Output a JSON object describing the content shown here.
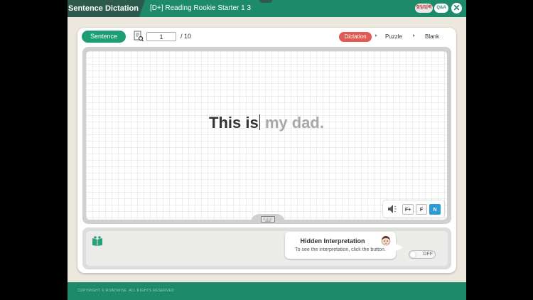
{
  "header": {
    "section_title": "Sentence Dictation",
    "book_title": "[D+] Reading Rookie Starter 1 3",
    "badge_answer": "정답입력",
    "badge_qa": "Q&A",
    "close_symbol": "✕"
  },
  "toolbar": {
    "mode_button": "Sentence",
    "current_page": "1",
    "total_pages": "/ 10",
    "tabs": [
      {
        "label": "Dictation",
        "active": true
      },
      {
        "label": "Puzzle",
        "active": false
      },
      {
        "label": "Blank",
        "active": false
      }
    ]
  },
  "board": {
    "typed_text": "This is",
    "remaining_text": "my dad."
  },
  "audio": {
    "speeds": [
      {
        "label": "F+",
        "active": false
      },
      {
        "label": "F",
        "active": false
      },
      {
        "label": "N",
        "active": true
      }
    ]
  },
  "interpretation": {
    "title": "Hidden Interpretation",
    "hint": "To see the interpretation, click the button.",
    "toggle_label": "OFF"
  },
  "footer": {
    "copyright": "COPYRIGHT © ROADWISE. ALL RIGHTS RESERVED"
  },
  "colors": {
    "brand_green": "#1d8a6a",
    "dark_green": "#2d5a4c",
    "pill_green": "#1e9e74",
    "active_tab_red": "#e15b53",
    "active_speed_blue": "#2c9bd6"
  }
}
